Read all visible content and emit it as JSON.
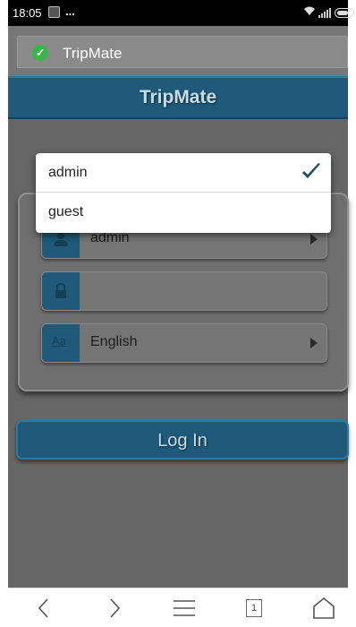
{
  "status_bar": {
    "time": "18:05",
    "overflow": "..."
  },
  "browser": {
    "page_title": "TripMate",
    "secure_icon": "shield-check-icon"
  },
  "app": {
    "header_title": "TripMate",
    "colors": {
      "primary": "#1f5a7a",
      "background": "#666666",
      "secure": "#3bb54a"
    },
    "form": {
      "user_field": {
        "value": "admin",
        "icon": "user-icon"
      },
      "password_field": {
        "value": "",
        "icon": "lock-icon"
      },
      "language_field": {
        "value": "English",
        "icon": "language-icon",
        "icon_text": "Aa"
      }
    },
    "login_label": "Log In"
  },
  "user_dropdown": {
    "options": [
      {
        "label": "admin",
        "selected": true
      },
      {
        "label": "guest",
        "selected": false
      }
    ]
  },
  "bottom_nav": {
    "tab_count": "1",
    "items": [
      "back-icon",
      "forward-icon",
      "menu-icon",
      "tabs-icon",
      "home-icon"
    ]
  }
}
